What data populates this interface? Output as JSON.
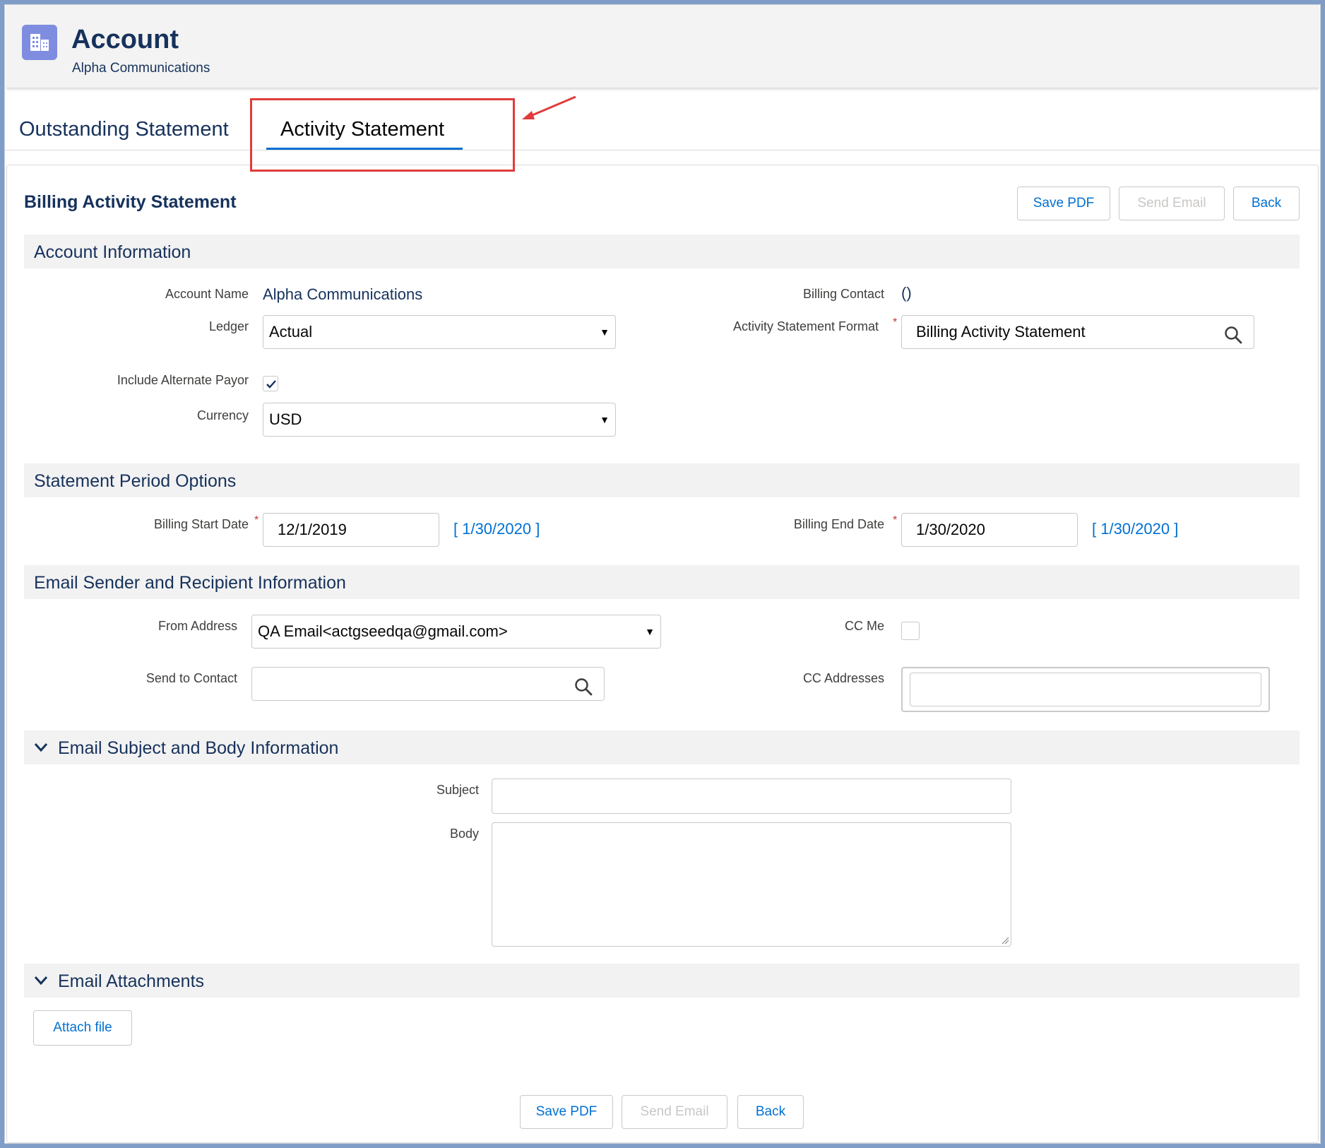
{
  "header": {
    "title": "Account",
    "subtitle": "Alpha Communications",
    "icon": "building-icon"
  },
  "tabs": [
    {
      "label": "Outstanding Statement"
    },
    {
      "label": "Activity Statement"
    }
  ],
  "card": {
    "title": "Billing Activity Statement",
    "buttons": {
      "save_pdf": "Save PDF",
      "send_email": "Send Email",
      "back": "Back"
    }
  },
  "account_info": {
    "title": "Account Information",
    "account_name_label": "Account Name",
    "account_name_value": "Alpha Communications",
    "billing_contact_label": "Billing Contact",
    "billing_contact_value": "()",
    "ledger_label": "Ledger",
    "ledger_value": "Actual",
    "format_label": "Activity Statement Format",
    "format_value": "Billing Activity Statement",
    "alt_payor_label": "Include Alternate Payor",
    "alt_payor_checked": true,
    "currency_label": "Currency",
    "currency_value": "USD"
  },
  "period": {
    "title": "Statement Period Options",
    "start_label": "Billing Start Date",
    "start_value": "12/1/2019",
    "start_link": "[ 1/30/2020 ]",
    "end_label": "Billing End Date",
    "end_value": "1/30/2020",
    "end_link": "[ 1/30/2020 ]"
  },
  "email_info": {
    "title": "Email Sender and Recipient Information",
    "from_label": "From Address",
    "from_value": "QA Email<actgseedqa@gmail.com>",
    "cc_me_label": "CC Me",
    "cc_me_checked": false,
    "send_to_label": "Send to Contact",
    "send_to_value": "",
    "cc_addresses_label": "CC Addresses",
    "cc_addresses_value": ""
  },
  "email_body": {
    "title": "Email Subject and Body Information",
    "subject_label": "Subject",
    "body_label": "Body"
  },
  "attachments": {
    "title": "Email Attachments",
    "attach_label": "Attach file"
  },
  "colors": {
    "brand": "#0070d2",
    "text": "#16325c",
    "icon_bg": "#7f8de1",
    "highlight": "#e03c3c"
  }
}
